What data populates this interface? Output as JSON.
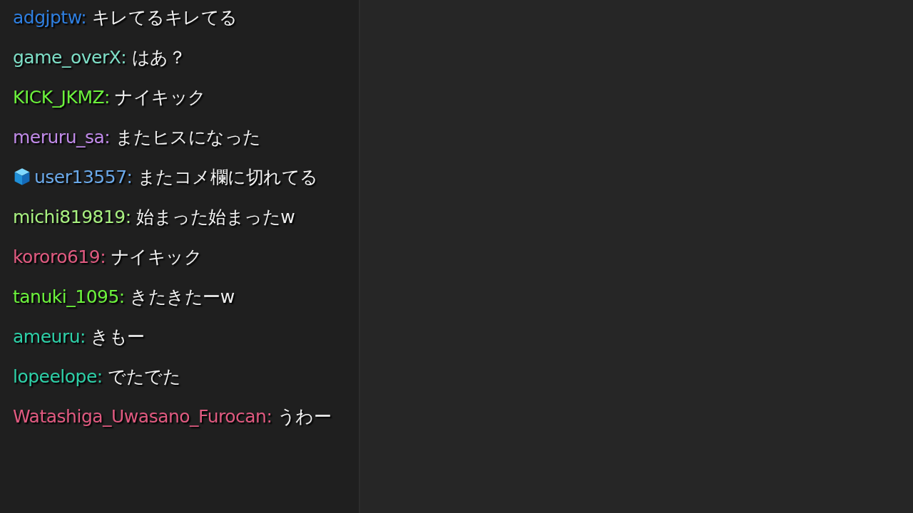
{
  "chat": {
    "messages": [
      {
        "user": "adgjptw:",
        "color": "#2f7fe0",
        "badge": false,
        "text": "キレてるキレてる"
      },
      {
        "user": "game_overX:",
        "color": "#7fe0c8",
        "badge": false,
        "text": "はあ？"
      },
      {
        "user": "KICK_JKMZ:",
        "color": "#6cf23c",
        "badge": false,
        "text": "ナイキック"
      },
      {
        "user": "meruru_sa:",
        "color": "#c08ae8",
        "badge": false,
        "text": "またヒスになった"
      },
      {
        "user": "user13557:",
        "color": "#6aa8e8",
        "badge": true,
        "text": "またコメ欄に切れてる"
      },
      {
        "user": "michi819819:",
        "color": "#a8f080",
        "badge": false,
        "text": "始まった始まったw"
      },
      {
        "user": "kororo619:",
        "color": "#e05a80",
        "badge": false,
        "text": "ナイキック"
      },
      {
        "user": "tanuki_1095:",
        "color": "#6cf23c",
        "badge": false,
        "text": "きたきたーw"
      },
      {
        "user": "ameuru:",
        "color": "#2ed0a8",
        "badge": false,
        "text": "きもー"
      },
      {
        "user": "lopeelope:",
        "color": "#2ed0a8",
        "badge": false,
        "text": "でたでた"
      },
      {
        "user": "Watashiga_Uwasano_Furocan:",
        "color": "#e05a80",
        "badge": false,
        "text": "うわー"
      }
    ]
  }
}
